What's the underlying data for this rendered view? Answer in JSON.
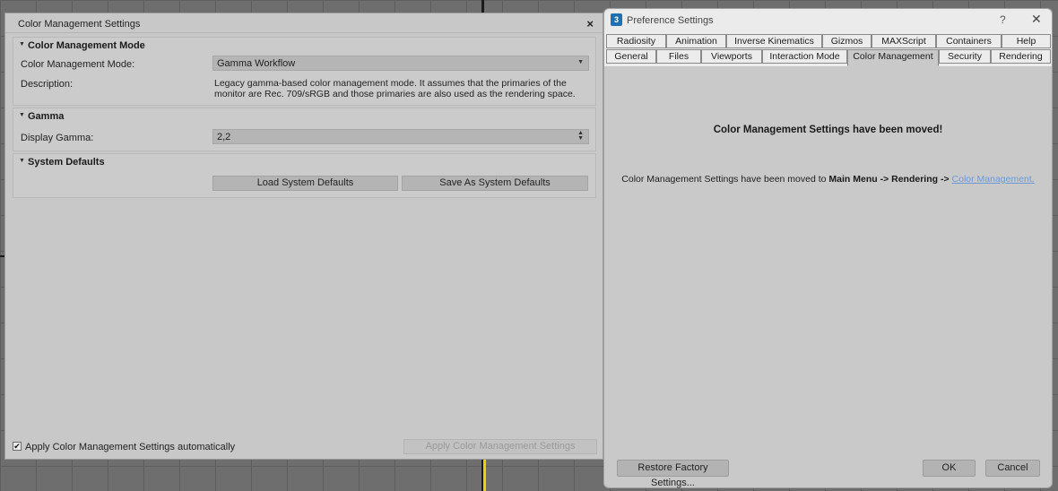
{
  "left_dialog": {
    "title": "Color Management Settings",
    "close_glyph": "×",
    "sections": {
      "mode": {
        "title": "Color Management Mode",
        "mode_label": "Color Management Mode:",
        "mode_value": "Gamma Workflow",
        "description_label": "Description:",
        "description_text": "Legacy gamma-based color management mode. It assumes that the primaries of the monitor are Rec. 709/sRGB and those primaries are also used as the rendering space."
      },
      "gamma": {
        "title": "Gamma",
        "display_gamma_label": "Display Gamma:",
        "display_gamma_value": "2,2"
      },
      "system_defaults": {
        "title": "System Defaults",
        "load_button": "Load System Defaults",
        "save_button": "Save As System Defaults"
      }
    },
    "footer": {
      "auto_apply_label": "Apply Color Management Settings automatically",
      "auto_apply_checked": true,
      "apply_button": "Apply Color Management Settings"
    }
  },
  "right_dialog": {
    "title": "Preference Settings",
    "help_glyph": "?",
    "close_glyph": "✕",
    "tabs_row1": [
      "Radiosity",
      "Animation",
      "Inverse Kinematics",
      "Gizmos",
      "MAXScript",
      "Containers",
      "Help"
    ],
    "tabs_row2": [
      "General",
      "Files",
      "Viewports",
      "Interaction Mode",
      "Color Management",
      "Security",
      "Rendering"
    ],
    "active_tab": "Color Management",
    "heading": "Color Management Settings have been moved!",
    "info_prefix": "Color Management Settings have been moved to ",
    "info_path": "Main Menu -> Rendering -> ",
    "info_link": "Color Management.",
    "restore_button": "Restore Factory Settings...",
    "ok_button": "OK",
    "cancel_button": "Cancel"
  },
  "colors": {
    "dialog_bg": "#c8c8c8",
    "link": "#6b9bd6",
    "viewport_bg": "#6e6e6e",
    "viewport_highlight": "#e8d400"
  }
}
